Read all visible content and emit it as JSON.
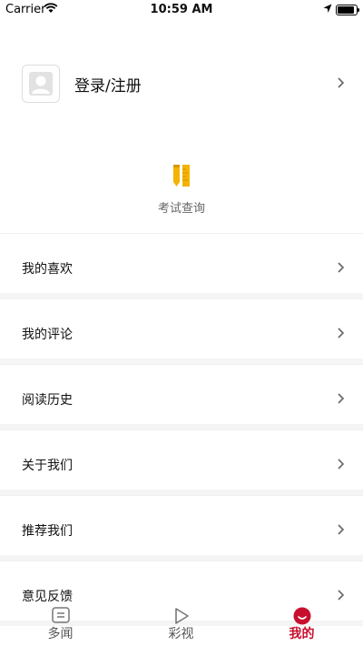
{
  "status_bar": {
    "carrier": "Carrier",
    "time": "10:59 AM",
    "battery_level": 0.9
  },
  "profile": {
    "label": "登录/注册"
  },
  "exam": {
    "label": "考试查询"
  },
  "menu": {
    "items": [
      {
        "label": "我的喜欢"
      },
      {
        "label": "我的评论"
      },
      {
        "label": "阅读历史"
      },
      {
        "label": "关于我们"
      },
      {
        "label": "推荐我们"
      },
      {
        "label": "意见反馈"
      }
    ]
  },
  "tabs": [
    {
      "label": "多闻",
      "icon": "news-icon",
      "active": false
    },
    {
      "label": "彩视",
      "icon": "play-icon",
      "active": false
    },
    {
      "label": "我的",
      "icon": "profile-smile-icon",
      "active": true
    }
  ],
  "colors": {
    "accent": "#c8102e",
    "exam_icon": "#f5b301"
  }
}
